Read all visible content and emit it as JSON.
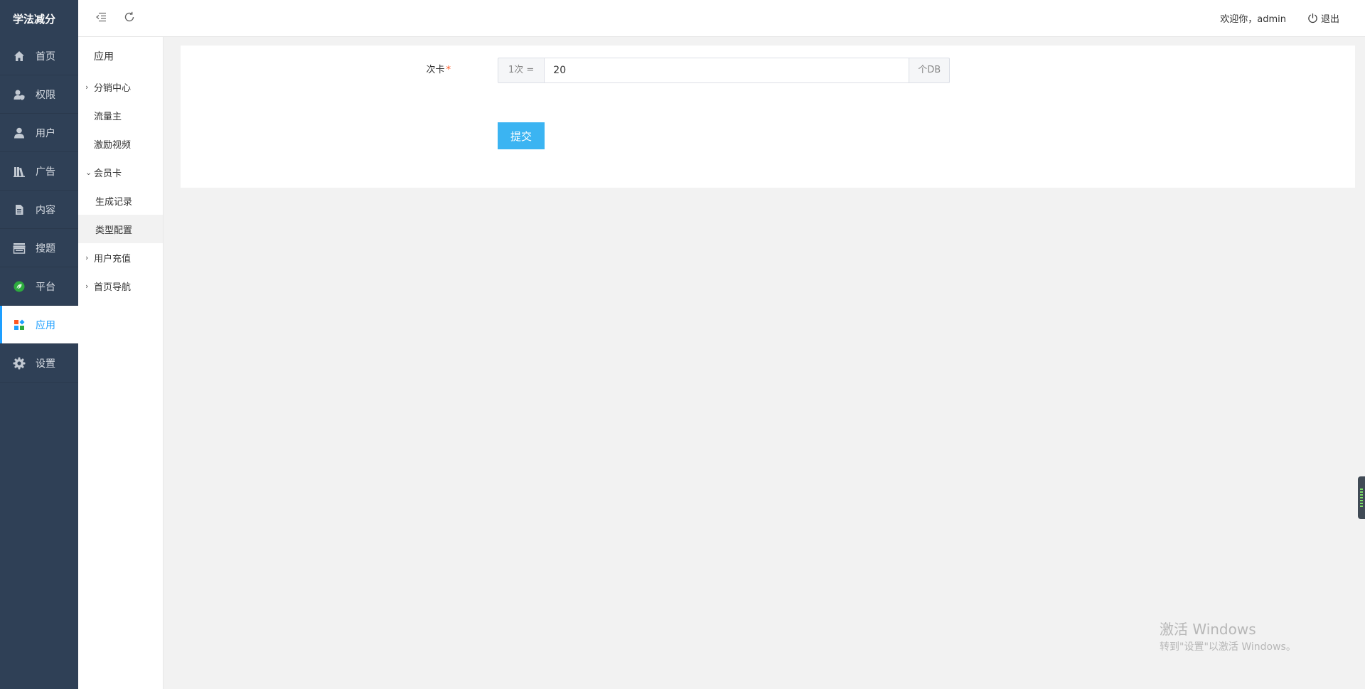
{
  "brand": "学法减分",
  "nav": [
    {
      "label": "首页",
      "icon": "home-icon"
    },
    {
      "label": "权限",
      "icon": "user-shield-icon"
    },
    {
      "label": "用户",
      "icon": "user-icon"
    },
    {
      "label": "广告",
      "icon": "books-icon"
    },
    {
      "label": "内容",
      "icon": "document-icon"
    },
    {
      "label": "搜题",
      "icon": "store-icon"
    },
    {
      "label": "平台",
      "icon": "leaf-icon"
    },
    {
      "label": "应用",
      "icon": "apps-icon"
    },
    {
      "label": "设置",
      "icon": "gear-icon"
    }
  ],
  "nav_active": "应用",
  "submenu": {
    "title": "应用",
    "items": [
      {
        "label": "分销中心",
        "arrow": "›"
      },
      {
        "label": "流量主",
        "arrow": ""
      },
      {
        "label": "激励视频",
        "arrow": ""
      },
      {
        "label": "会员卡",
        "arrow": "⌄"
      },
      {
        "label": "生成记录",
        "arrow": ""
      },
      {
        "label": "类型配置",
        "arrow": ""
      },
      {
        "label": "用户充值",
        "arrow": "›"
      },
      {
        "label": "首页导航",
        "arrow": "›"
      }
    ]
  },
  "header": {
    "welcome": "欢迎你，admin",
    "logout": "退出"
  },
  "form": {
    "label": "次卡",
    "required_mark": "*",
    "prefix": "1次 =",
    "value": "20",
    "suffix": "个DB",
    "submit": "提交"
  },
  "watermark": {
    "title": "激活 Windows",
    "subtitle": "转到\"设置\"以激活 Windows。"
  },
  "colors": {
    "sidebar": "#2f4056",
    "accent": "#1e9fff",
    "submit": "#3bb4f2"
  }
}
